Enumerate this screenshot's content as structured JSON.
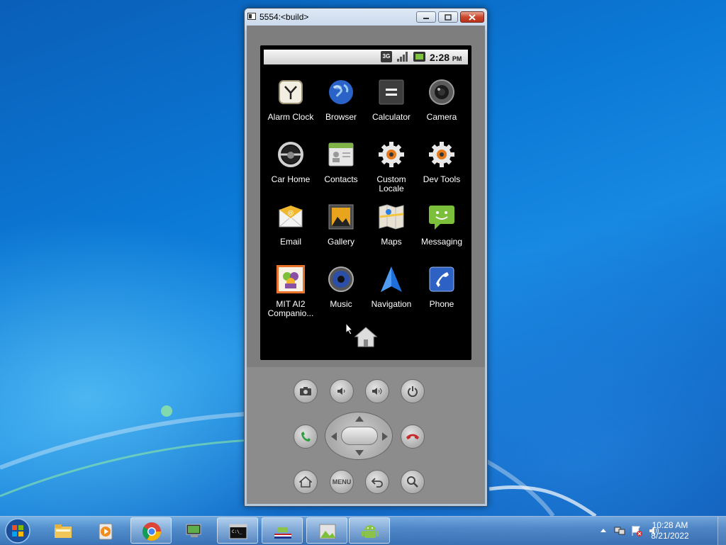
{
  "window": {
    "title": "5554:<build>",
    "buttons": {
      "minimize": "minimize",
      "maximize": "maximize",
      "close": "close"
    }
  },
  "statusbar": {
    "network": "3G",
    "time": "2:28",
    "ampm": "PM"
  },
  "apps": [
    {
      "label": "Alarm Clock",
      "icon": "alarm-clock-icon"
    },
    {
      "label": "Browser",
      "icon": "globe-icon"
    },
    {
      "label": "Calculator",
      "icon": "calculator-icon"
    },
    {
      "label": "Camera",
      "icon": "camera-icon"
    },
    {
      "label": "Car Home",
      "icon": "steering-wheel-icon"
    },
    {
      "label": "Contacts",
      "icon": "contacts-icon"
    },
    {
      "label": "Custom Locale",
      "icon": "gear-icon"
    },
    {
      "label": "Dev Tools",
      "icon": "gear-icon"
    },
    {
      "label": "Email",
      "icon": "envelope-icon"
    },
    {
      "label": "Gallery",
      "icon": "picture-icon"
    },
    {
      "label": "Maps",
      "icon": "map-icon"
    },
    {
      "label": "Messaging",
      "icon": "speech-bubble-icon"
    },
    {
      "label": "MIT AI2 Companio...",
      "icon": "mit-ai2-icon"
    },
    {
      "label": "Music",
      "icon": "speaker-icon"
    },
    {
      "label": "Navigation",
      "icon": "navigation-arrow-icon"
    },
    {
      "label": "Phone",
      "icon": "phone-icon"
    }
  ],
  "hardware": {
    "menu_label": "MENU"
  },
  "taskbar": {
    "clock_time": "10:28 AM",
    "clock_date": "8/21/2022"
  },
  "colors": {
    "desktop": "#0b79d6",
    "phone_body": "#838383",
    "screen": "#000000"
  }
}
